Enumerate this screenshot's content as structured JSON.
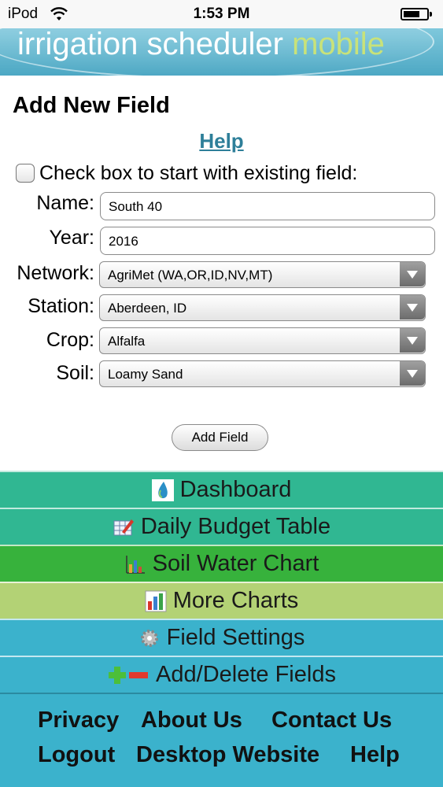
{
  "status_bar": {
    "carrier": "iPod",
    "time": "1:53 PM"
  },
  "banner": {
    "title_main": "irrigation scheduler ",
    "title_accent": "mobile"
  },
  "form": {
    "title": "Add New Field",
    "help_link": "Help",
    "existing_checkbox_label": "Check box to start with existing field:",
    "existing_checked": false,
    "fields": {
      "name": {
        "label": "Name:",
        "value": "South 40"
      },
      "year": {
        "label": "Year:",
        "value": "2016"
      },
      "network": {
        "label": "Network:",
        "value": "AgriMet (WA,OR,ID,NV,MT)"
      },
      "station": {
        "label": "Station:",
        "value": "Aberdeen, ID"
      },
      "crop": {
        "label": "Crop:",
        "value": "Alfalfa"
      },
      "soil": {
        "label": "Soil:",
        "value": "Loamy Sand"
      }
    },
    "add_button": "Add Field"
  },
  "nav": [
    {
      "label": "Dashboard",
      "icon": "water-drop-icon",
      "color": "#30b792"
    },
    {
      "label": "Daily Budget Table",
      "icon": "table-pencil-icon",
      "color": "#30b792"
    },
    {
      "label": "Soil Water Chart",
      "icon": "line-chart-icon",
      "color": "#37b23c"
    },
    {
      "label": "More Charts",
      "icon": "bar-chart-icon",
      "color": "#b3d275"
    },
    {
      "label": "Field Settings",
      "icon": "gear-icon",
      "color": "#3bb2cc"
    },
    {
      "label": "Add/Delete Fields",
      "icon": "plus-minus-icon",
      "color": "#3bb2cc"
    }
  ],
  "footer": {
    "privacy": "Privacy",
    "about": "About Us",
    "contact": "Contact Us",
    "logout": "Logout",
    "desktop": "Desktop Website",
    "help": "Help"
  }
}
